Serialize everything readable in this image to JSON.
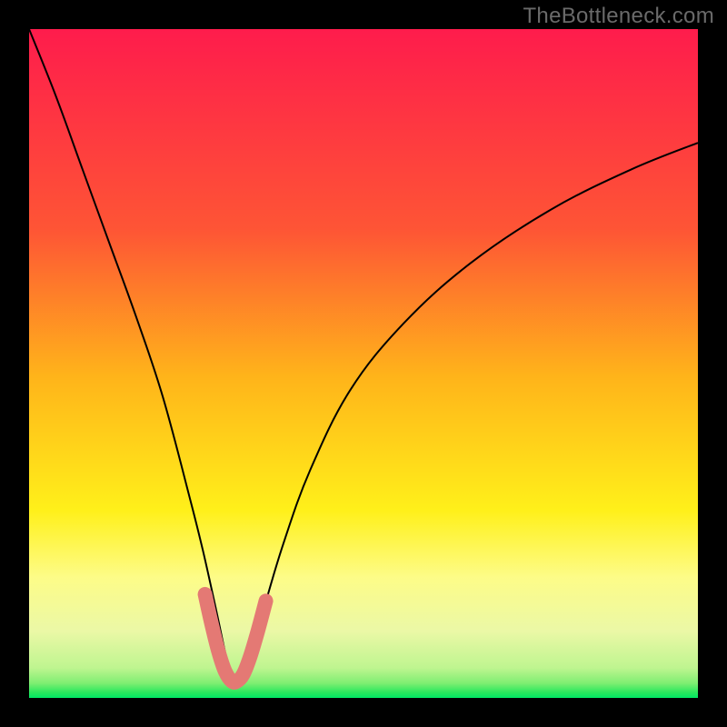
{
  "watermark": "TheBottleneck.com",
  "chart_data": {
    "type": "line",
    "title": "",
    "xlabel": "",
    "ylabel": "",
    "xlim": [
      0,
      100
    ],
    "ylim": [
      0,
      100
    ],
    "grid": false,
    "background_gradient_stops": [
      {
        "offset": 0.0,
        "color": "#fe1c4c"
      },
      {
        "offset": 0.3,
        "color": "#fe5535"
      },
      {
        "offset": 0.52,
        "color": "#ffb41a"
      },
      {
        "offset": 0.72,
        "color": "#fff01a"
      },
      {
        "offset": 0.82,
        "color": "#fdfc88"
      },
      {
        "offset": 0.9,
        "color": "#ebf8a6"
      },
      {
        "offset": 0.955,
        "color": "#bff590"
      },
      {
        "offset": 0.978,
        "color": "#7fee72"
      },
      {
        "offset": 0.992,
        "color": "#28e85c"
      },
      {
        "offset": 1.0,
        "color": "#00e864"
      }
    ],
    "series": [
      {
        "name": "bottleneck-curve",
        "color": "#000000",
        "x": [
          0,
          4,
          8,
          12,
          16,
          20,
          24,
          26,
          28,
          29.5,
          30.5,
          31.5,
          33,
          35,
          38,
          42,
          48,
          56,
          66,
          78,
          90,
          100
        ],
        "y": [
          100,
          90,
          79,
          68,
          57,
          45,
          30,
          22,
          13,
          6,
          2.5,
          2.5,
          6,
          13,
          23,
          34,
          46,
          56,
          65,
          73,
          79,
          83
        ]
      },
      {
        "name": "valley-highlight",
        "color": "#e47974",
        "stroke_width": 16,
        "linecap": "round",
        "x": [
          26.3,
          27.3,
          28.3,
          29.3,
          30.3,
          31.1,
          32.0,
          33.0,
          34.2,
          35.4
        ],
        "y": [
          15.5,
          11.0,
          7.0,
          4.0,
          2.5,
          2.5,
          3.5,
          6.0,
          10.0,
          14.5
        ]
      }
    ]
  }
}
